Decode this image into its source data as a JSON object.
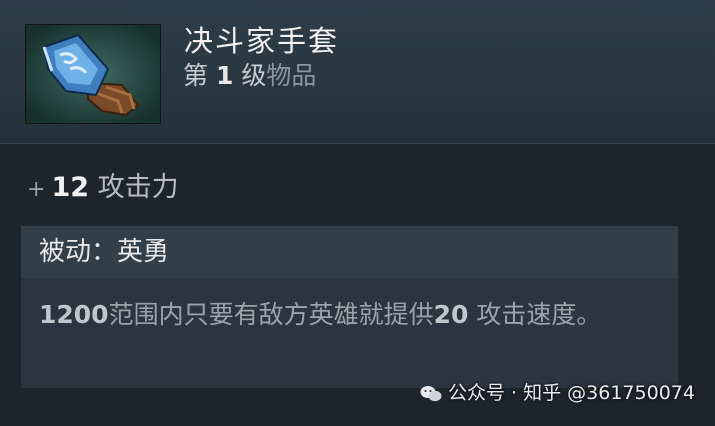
{
  "item": {
    "name": "决斗家手套",
    "level_prefix": "第",
    "level_number": "1",
    "level_suffix": "级",
    "item_kind": "物品",
    "icon": "gauntlet-icon"
  },
  "stat": {
    "plus": "+",
    "value": "12",
    "label": "攻击力"
  },
  "ability": {
    "title": "被动：英勇",
    "desc_part1": "1200",
    "desc_part2": "范围内只要有敌方英雄就提供",
    "desc_part3": "20",
    "desc_part4": " 攻击速度。"
  },
  "watermark": {
    "text": "公众号 · 知乎 @361750074",
    "icon": "wechat-icon"
  }
}
